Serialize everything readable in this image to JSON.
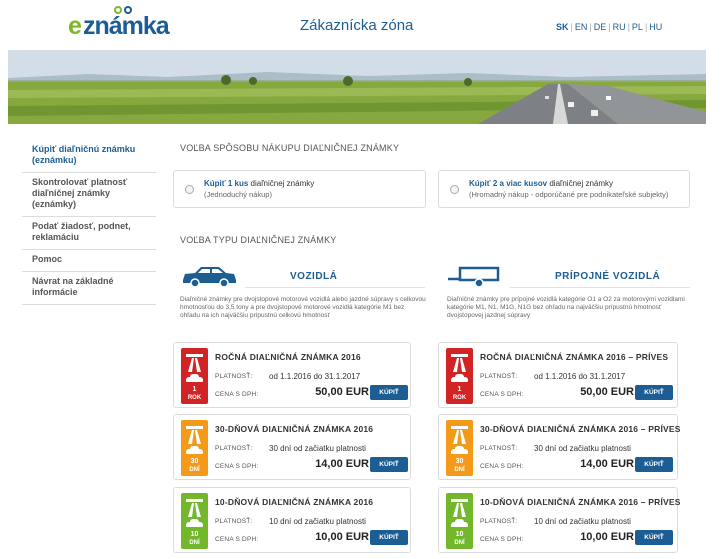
{
  "header": {
    "logo_e": "e",
    "logo_rest": "známka",
    "title": "Zákaznícka zóna",
    "languages": [
      "SK",
      "EN",
      "DE",
      "RU",
      "PL",
      "HU"
    ],
    "active_language": "SK"
  },
  "sidebar": {
    "items": [
      {
        "label": "Kúpiť diaľničnú známku (eznámku)"
      },
      {
        "label": "Skontrolovať platnosť diaľničnej známky (eznámky)"
      },
      {
        "label": "Podať žiadosť, podnet, reklamáciu"
      },
      {
        "label": "Pomoc"
      },
      {
        "label": "Návrat na základné informácie"
      }
    ]
  },
  "purchase": {
    "title": "VOĽBA SPÔSOBU NÁKUPU DIAĽNIČNEJ ZNÁMKY",
    "single": {
      "pre": "Kúpiť",
      "count": "1 kus",
      "post": "diaľničnej známky",
      "sub": "(Jednoduchý nákup)"
    },
    "multi": {
      "pre": "Kúpiť",
      "count": "2 a viac kusov",
      "post": "diaľničnej známky",
      "sub": "(Hromadný nákup - odporúčané pre podnikateľské subjekty)"
    }
  },
  "type": {
    "title": "VOĽBA TYPU DIAĽNIČNEJ ZNÁMKY",
    "vehicles": {
      "heading": "VOZIDLÁ",
      "description": "Diaľničné známky pre dvojstopové motorové vozidlá alebo jazdné súpravy s celkovou hmotnosťou do 3,5 tony a pre dvojstopové motorové vozidlá kategórie M1 bez ohľadu na ich najväčšiu prípustnú celkovú hmotnosť"
    },
    "trailers": {
      "heading": "PRÍPOJNÉ VOZIDLÁ",
      "description": "Diaľničné známky pre prípojné vozidlá kategórie O1 a O2 za motorovými vozidlami kategórie M1, N1, M1G, N1G bez ohľadu na najväčšiu prípustnú hmotnosť dvojstopovej jazdnej súpravy"
    }
  },
  "labels": {
    "validity": "PLATNOSŤ:",
    "price": "CENA S DPH:",
    "buy": "KÚPIŤ"
  },
  "cards": [
    {
      "title": "ROČNÁ DIAĽNIČNÁ ZNÁMKA 2016",
      "validity": "od 1.1.2016 do 31.1.2017",
      "price": "50,00 EUR",
      "badge_value": "1",
      "badge_unit": "ROK",
      "color": "#d22424"
    },
    {
      "title": "ROČNÁ DIAĽNIČNÁ ZNÁMKA 2016 – PRÍVES",
      "validity": "od 1.1.2016 do 31.1.2017",
      "price": "50,00 EUR",
      "badge_value": "1",
      "badge_unit": "ROK",
      "color": "#d22424"
    },
    {
      "title": "30-DŇOVÁ DIAĽNIČNÁ ZNÁMKA 2016",
      "validity": "30 dní od začiatku platnosti",
      "price": "14,00 EUR",
      "badge_value": "30",
      "badge_unit": "DNÍ",
      "color": "#f49a1a"
    },
    {
      "title": "30-DŇOVÁ DIAĽNIČNÁ ZNÁMKA 2016 – PRÍVES",
      "validity": "30 dní od začiatku platnosti",
      "price": "14,00 EUR",
      "badge_value": "30",
      "badge_unit": "DNÍ",
      "color": "#f49a1a"
    },
    {
      "title": "10-DŇOVÁ DIAĽNIČNÁ ZNÁMKA 2016",
      "validity": "10 dní od začiatku platnosti",
      "price": "10,00 EUR",
      "badge_value": "10",
      "badge_unit": "DNÍ",
      "color": "#72b72c"
    },
    {
      "title": "10-DŇOVÁ DIAĽNIČNÁ ZNÁMKA 2016 – PRÍVES",
      "validity": "10 dní od začiatku platnosti",
      "price": "10,00 EUR",
      "badge_value": "10",
      "badge_unit": "DNÍ",
      "color": "#72b72c"
    }
  ]
}
